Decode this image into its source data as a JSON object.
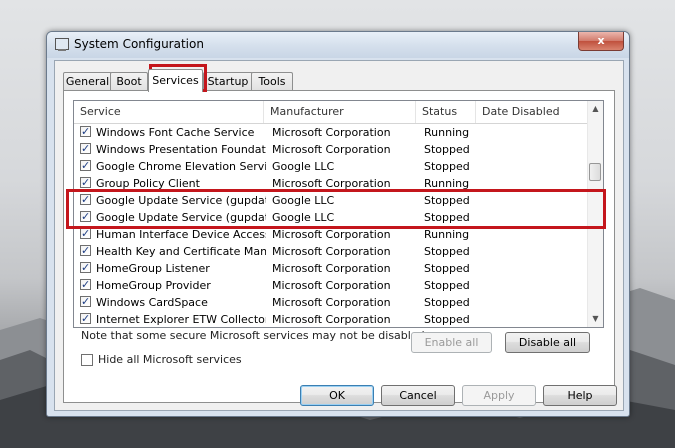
{
  "window": {
    "title": "System Configuration",
    "close_label": "x"
  },
  "tabs": [
    "General",
    "Boot",
    "Services",
    "Startup",
    "Tools"
  ],
  "list": {
    "columns": [
      "Service",
      "Manufacturer",
      "Status",
      "Date Disabled"
    ],
    "rows": [
      {
        "service": "Windows Font Cache Service",
        "manufacturer": "Microsoft Corporation",
        "status": "Running"
      },
      {
        "service": "Windows Presentation Foundati...",
        "manufacturer": "Microsoft Corporation",
        "status": "Stopped"
      },
      {
        "service": "Google Chrome Elevation Servic...",
        "manufacturer": "Google LLC",
        "status": "Stopped"
      },
      {
        "service": "Group Policy Client",
        "manufacturer": "Microsoft Corporation",
        "status": "Running"
      },
      {
        "service": "Google Update Service (gupdate)",
        "manufacturer": "Google LLC",
        "status": "Stopped"
      },
      {
        "service": "Google Update Service (gupdatem)",
        "manufacturer": "Google LLC",
        "status": "Stopped"
      },
      {
        "service": "Human Interface Device Access",
        "manufacturer": "Microsoft Corporation",
        "status": "Running"
      },
      {
        "service": "Health Key and Certificate Mana...",
        "manufacturer": "Microsoft Corporation",
        "status": "Stopped"
      },
      {
        "service": "HomeGroup Listener",
        "manufacturer": "Microsoft Corporation",
        "status": "Stopped"
      },
      {
        "service": "HomeGroup Provider",
        "manufacturer": "Microsoft Corporation",
        "status": "Stopped"
      },
      {
        "service": "Windows CardSpace",
        "manufacturer": "Microsoft Corporation",
        "status": "Stopped"
      },
      {
        "service": "Internet Explorer ETW Collector ...",
        "manufacturer": "Microsoft Corporation",
        "status": "Stopped"
      }
    ]
  },
  "note": "Note that some secure Microsoft services may not be disabled.",
  "buttons": {
    "enable_all": "Enable all",
    "disable_all": "Disable all",
    "ok": "OK",
    "cancel": "Cancel",
    "apply": "Apply",
    "help": "Help"
  },
  "hide_ms_label": "Hide all Microsoft services",
  "colors": {
    "highlight": "#c4161c",
    "title_bar": "#d4dfec"
  }
}
